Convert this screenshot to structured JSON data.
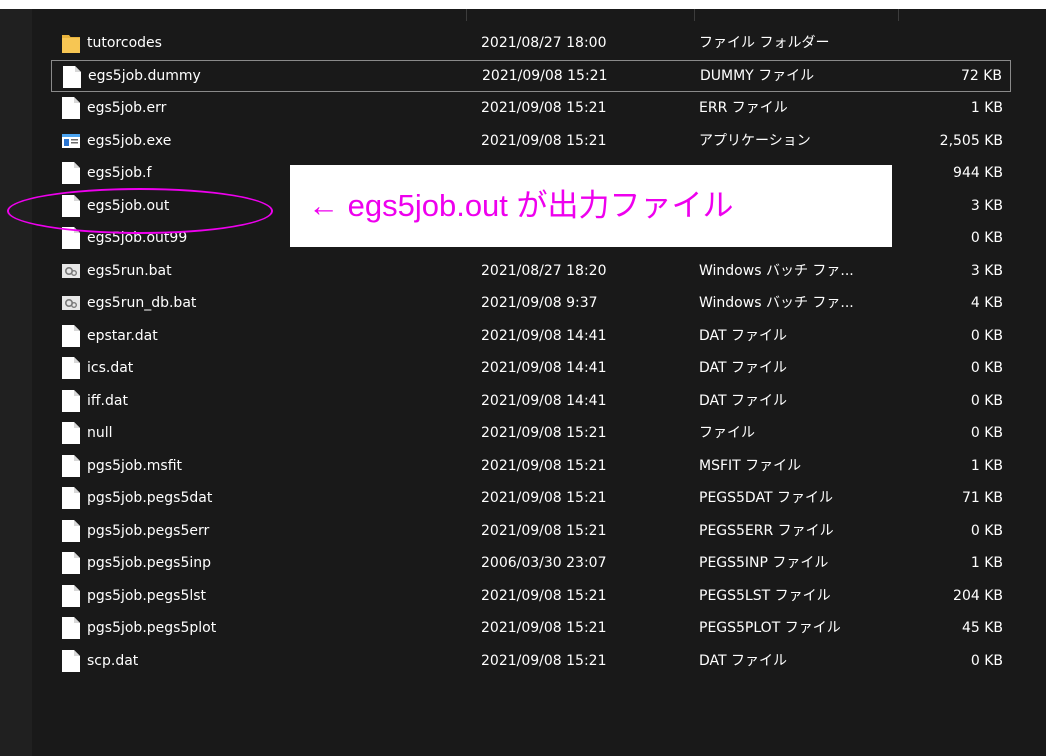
{
  "files": [
    {
      "name": "tutorcodes",
      "date": "2021/08/27 18:00",
      "type": "ファイル フォルダー",
      "size": "",
      "icon": "folder-icon"
    },
    {
      "name": "egs5job.dummy",
      "date": "2021/09/08 15:21",
      "type": "DUMMY ファイル",
      "size": "72 KB",
      "icon": "file-icon"
    },
    {
      "name": "egs5job.err",
      "date": "2021/09/08 15:21",
      "type": "ERR ファイル",
      "size": "1 KB",
      "icon": "file-icon"
    },
    {
      "name": "egs5job.exe",
      "date": "2021/09/08 15:21",
      "type": "アプリケーション",
      "size": "2,505 KB",
      "icon": "application-icon"
    },
    {
      "name": "egs5job.f",
      "date": "",
      "type": "",
      "size": "944 KB",
      "icon": "file-icon"
    },
    {
      "name": "egs5job.out",
      "date": "",
      "type": "",
      "size": "3 KB",
      "icon": "file-icon"
    },
    {
      "name": "egs5job.out99",
      "date": "",
      "type": "",
      "size": "0 KB",
      "icon": "file-icon"
    },
    {
      "name": "egs5run.bat",
      "date": "2021/08/27 18:20",
      "type": "Windows バッチ ファ...",
      "size": "3 KB",
      "icon": "batch-file-icon"
    },
    {
      "name": "egs5run_db.bat",
      "date": "2021/09/08 9:37",
      "type": "Windows バッチ ファ...",
      "size": "4 KB",
      "icon": "batch-file-icon"
    },
    {
      "name": "epstar.dat",
      "date": "2021/09/08 14:41",
      "type": "DAT ファイル",
      "size": "0 KB",
      "icon": "file-icon"
    },
    {
      "name": "ics.dat",
      "date": "2021/09/08 14:41",
      "type": "DAT ファイル",
      "size": "0 KB",
      "icon": "file-icon"
    },
    {
      "name": "iff.dat",
      "date": "2021/09/08 14:41",
      "type": "DAT ファイル",
      "size": "0 KB",
      "icon": "file-icon"
    },
    {
      "name": "null",
      "date": "2021/09/08 15:21",
      "type": "ファイル",
      "size": "0 KB",
      "icon": "file-icon"
    },
    {
      "name": "pgs5job.msfit",
      "date": "2021/09/08 15:21",
      "type": "MSFIT ファイル",
      "size": "1 KB",
      "icon": "file-icon"
    },
    {
      "name": "pgs5job.pegs5dat",
      "date": "2021/09/08 15:21",
      "type": "PEGS5DAT ファイル",
      "size": "71 KB",
      "icon": "file-icon"
    },
    {
      "name": "pgs5job.pegs5err",
      "date": "2021/09/08 15:21",
      "type": "PEGS5ERR ファイル",
      "size": "0 KB",
      "icon": "file-icon"
    },
    {
      "name": "pgs5job.pegs5inp",
      "date": "2006/03/30 23:07",
      "type": "PEGS5INP ファイル",
      "size": "1 KB",
      "icon": "file-icon"
    },
    {
      "name": "pgs5job.pegs5lst",
      "date": "2021/09/08 15:21",
      "type": "PEGS5LST ファイル",
      "size": "204 KB",
      "icon": "file-icon"
    },
    {
      "name": "pgs5job.pegs5plot",
      "date": "2021/09/08 15:21",
      "type": "PEGS5PLOT ファイル",
      "size": "45 KB",
      "icon": "file-icon"
    },
    {
      "name": "scp.dat",
      "date": "2021/09/08 15:21",
      "type": "DAT ファイル",
      "size": "0 KB",
      "icon": "file-icon"
    }
  ],
  "selected_index": 1,
  "annotation": {
    "text": "← egs5job.out が出力ファイル",
    "color": "#ee00ee"
  }
}
